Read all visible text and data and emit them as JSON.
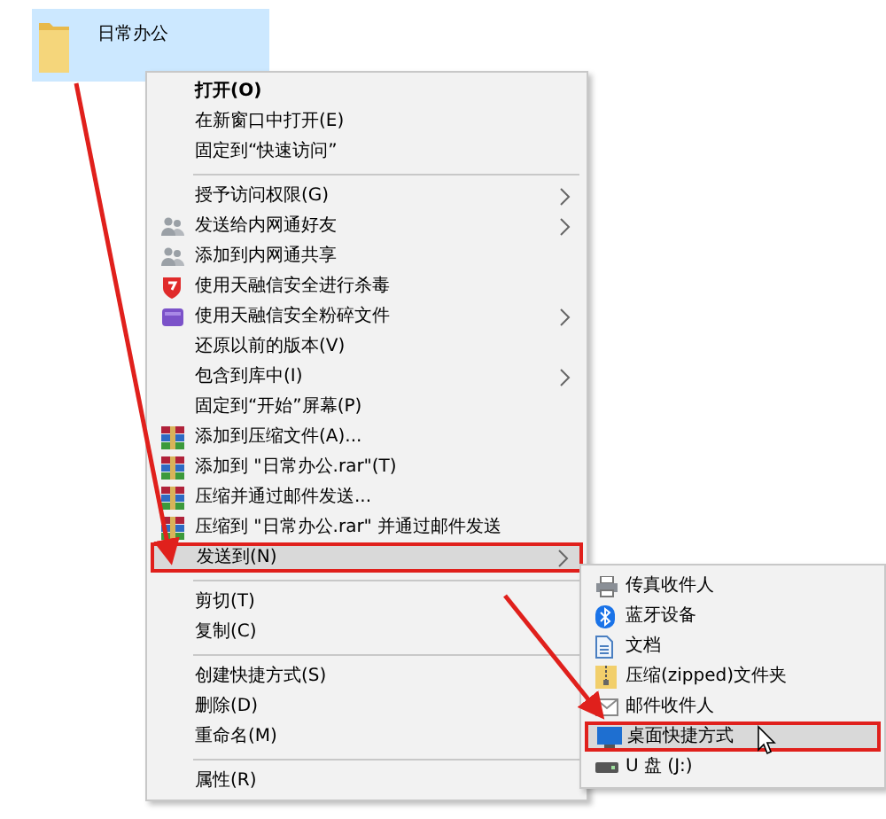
{
  "folder": {
    "name": "日常办公",
    "selected": true
  },
  "context_menu": {
    "items": [
      {
        "kind": "item",
        "label": "打开(O)",
        "bold": true,
        "submenu": false,
        "selected": false
      },
      {
        "kind": "item",
        "label": "在新窗口中打开(E)",
        "bold": false,
        "submenu": false,
        "selected": false
      },
      {
        "kind": "item",
        "label": "固定到“快速访问”",
        "bold": false,
        "submenu": false,
        "selected": false
      },
      {
        "kind": "separator"
      },
      {
        "kind": "item",
        "label": "授予访问权限(G)",
        "bold": false,
        "submenu": true,
        "selected": false
      },
      {
        "kind": "item",
        "label": "发送给内网通好友",
        "bold": false,
        "submenu": true,
        "selected": false
      },
      {
        "kind": "item",
        "label": "添加到内网通共享",
        "bold": false,
        "submenu": false,
        "selected": false
      },
      {
        "kind": "item",
        "label": "使用天融信安全进行杀毒",
        "bold": false,
        "submenu": false,
        "selected": false
      },
      {
        "kind": "item",
        "label": "使用天融信安全粉碎文件",
        "bold": false,
        "submenu": true,
        "selected": false
      },
      {
        "kind": "item",
        "label": "还原以前的版本(V)",
        "bold": false,
        "submenu": false,
        "selected": false
      },
      {
        "kind": "item",
        "label": "包含到库中(I)",
        "bold": false,
        "submenu": true,
        "selected": false
      },
      {
        "kind": "item",
        "label": "固定到“开始”屏幕(P)",
        "bold": false,
        "submenu": false,
        "selected": false
      },
      {
        "kind": "item",
        "label": "添加到压缩文件(A)...",
        "bold": false,
        "submenu": false,
        "selected": false
      },
      {
        "kind": "item",
        "label": "添加到 \"日常办公.rar\"(T)",
        "bold": false,
        "submenu": false,
        "selected": false
      },
      {
        "kind": "item",
        "label": "压缩并通过邮件发送...",
        "bold": false,
        "submenu": false,
        "selected": false
      },
      {
        "kind": "item",
        "label": "压缩到 \"日常办公.rar\" 并通过邮件发送",
        "bold": false,
        "submenu": false,
        "selected": false
      },
      {
        "kind": "item",
        "label": "发送到(N)",
        "bold": false,
        "submenu": true,
        "selected": true
      },
      {
        "kind": "separator"
      },
      {
        "kind": "item",
        "label": "剪切(T)",
        "bold": false,
        "submenu": false,
        "selected": false
      },
      {
        "kind": "item",
        "label": "复制(C)",
        "bold": false,
        "submenu": false,
        "selected": false
      },
      {
        "kind": "separator"
      },
      {
        "kind": "item",
        "label": "创建快捷方式(S)",
        "bold": false,
        "submenu": false,
        "selected": false
      },
      {
        "kind": "item",
        "label": "删除(D)",
        "bold": false,
        "submenu": false,
        "selected": false
      },
      {
        "kind": "item",
        "label": "重命名(M)",
        "bold": false,
        "submenu": false,
        "selected": false
      },
      {
        "kind": "separator"
      },
      {
        "kind": "item",
        "label": "属性(R)",
        "bold": false,
        "submenu": false,
        "selected": false
      }
    ]
  },
  "send_to_menu": {
    "items": [
      {
        "label": "传真收件人",
        "selected": false
      },
      {
        "label": "蓝牙设备",
        "selected": false
      },
      {
        "label": "文档",
        "selected": false
      },
      {
        "label": "压缩(zipped)文件夹",
        "selected": false
      },
      {
        "label": "邮件收件人",
        "selected": false
      },
      {
        "label": "桌面快捷方式",
        "selected": true
      },
      {
        "label": "U 盘 (J:)",
        "selected": false
      }
    ]
  }
}
